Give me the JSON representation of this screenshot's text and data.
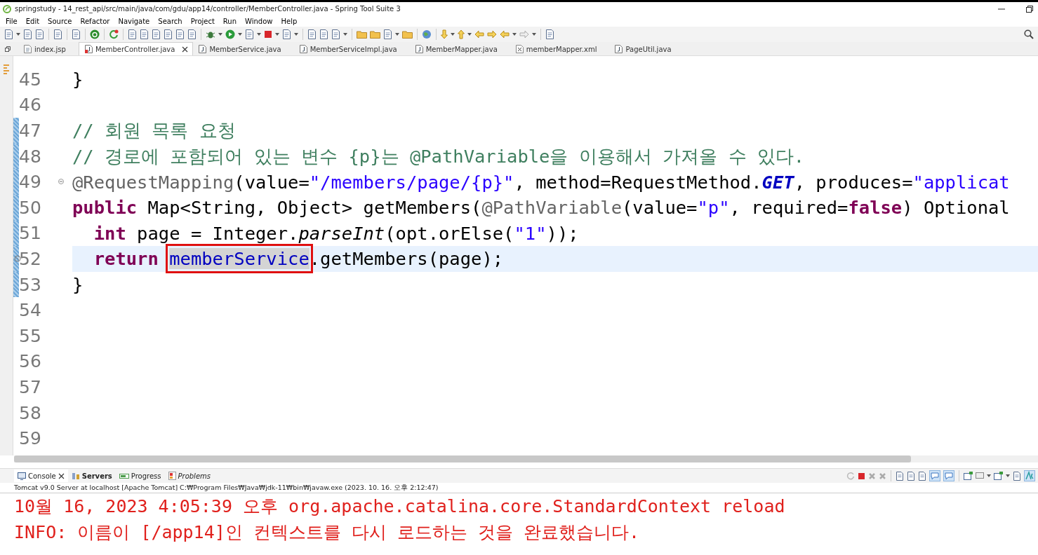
{
  "window": {
    "title": "springstudy - 14_rest_api/src/main/java/com/gdu/app14/controller/MemberController.java - Spring Tool Suite 3"
  },
  "menu": [
    "File",
    "Edit",
    "Source",
    "Refactor",
    "Navigate",
    "Search",
    "Project",
    "Run",
    "Window",
    "Help"
  ],
  "editor_tabs": [
    {
      "label": "index.jsp",
      "kind": "jsp",
      "selected": false
    },
    {
      "label": "MemberController.java",
      "kind": "java",
      "selected": true
    },
    {
      "label": "MemberService.java",
      "kind": "java",
      "selected": false
    },
    {
      "label": "MemberServiceImpl.java",
      "kind": "java",
      "selected": false
    },
    {
      "label": "MemberMapper.java",
      "kind": "java",
      "selected": false
    },
    {
      "label": "memberMapper.xml",
      "kind": "xml",
      "selected": false
    },
    {
      "label": "PageUtil.java",
      "kind": "java",
      "selected": false
    }
  ],
  "code_lines": [
    {
      "number": "45",
      "changed": false,
      "current": false,
      "tokens": [
        {
          "kind": "plain",
          "text": "}"
        }
      ]
    },
    {
      "number": "46",
      "changed": false,
      "current": false
    },
    {
      "number": "47",
      "changed": true,
      "current": false,
      "tokens": [
        {
          "kind": "comment",
          "text": "// 회원 목록 요청"
        }
      ]
    },
    {
      "number": "48",
      "changed": true,
      "current": false,
      "tokens": [
        {
          "kind": "comment",
          "text": "// 경로에 포함되어 있는 변수 {p}는 @PathVariable을 이용해서 가져올 수 있다."
        }
      ]
    },
    {
      "number": "49",
      "changed": true,
      "current": false,
      "folding": true,
      "tokens": [
        {
          "kind": "annotation",
          "text": "@RequestMapping"
        },
        {
          "kind": "plain",
          "text": "(value="
        },
        {
          "kind": "string",
          "text": "\"/members/page/{p}\""
        },
        {
          "kind": "plain",
          "text": ", method=RequestMethod."
        },
        {
          "kind": "constant",
          "text": "GET"
        },
        {
          "kind": "plain",
          "text": ", produces="
        },
        {
          "kind": "string",
          "text": "\"applicat"
        }
      ]
    },
    {
      "number": "50",
      "changed": true,
      "current": false,
      "children": [
        {
          "number": "51",
          "changed": true,
          "current": false,
          "tokens": [
            {
              "kind": "keyword",
              "text": "int"
            },
            {
              "kind": "plain",
              "text": " page = Integer."
            },
            {
              "kind": "static",
              "text": "parseInt"
            },
            {
              "kind": "plain",
              "text": "(opt.orElse("
            },
            {
              "kind": "string",
              "text": "\"1\""
            },
            {
              "kind": "plain",
              "text": "));"
            }
          ]
        },
        {
          "number": "52",
          "changed": true,
          "current": true,
          "warning": true,
          "tokens": [
            {
              "kind": "keyword",
              "text": "return "
            },
            {
              "kind": "field",
              "text": "memberService",
              "occurrence": true,
              "boxed": true
            },
            {
              "kind": "plain",
              "text": ".getMembers(page);"
            }
          ]
        }
      ],
      "tokens": [
        {
          "kind": "keyword",
          "text": "public"
        },
        {
          "kind": "plain",
          "text": " Map<String, Object> getMembers("
        },
        {
          "kind": "annotation",
          "text": "@PathVariable"
        },
        {
          "kind": "plain",
          "text": "(value="
        },
        {
          "kind": "string",
          "text": "\"p\""
        },
        {
          "kind": "plain",
          "text": ", required="
        },
        {
          "kind": "keyword",
          "text": "false"
        },
        {
          "kind": "plain",
          "text": ") Optional"
        }
      ]
    },
    {
      "number": "53",
      "changed": true,
      "current": false,
      "tokens": [
        {
          "kind": "plain",
          "text": "}"
        }
      ]
    },
    {
      "number": "54",
      "changed": false,
      "current": false
    },
    {
      "number": "55",
      "changed": false,
      "current": false
    },
    {
      "number": "56",
      "changed": false,
      "current": false
    },
    {
      "number": "57",
      "changed": false,
      "current": false
    },
    {
      "number": "58",
      "changed": false,
      "current": false
    },
    {
      "number": "59",
      "changed": false,
      "current": false
    }
  ],
  "console_tabs": [
    {
      "label": "Console",
      "kind": "console",
      "selected": true,
      "highlighted": false,
      "italic": false
    },
    {
      "label": "Servers",
      "kind": "servers",
      "selected": false,
      "highlighted": true,
      "italic": false
    },
    {
      "label": "Progress",
      "kind": "progress",
      "selected": false,
      "highlighted": false,
      "italic": false
    },
    {
      "label": "Problems",
      "kind": "problems",
      "selected": false,
      "highlighted": false,
      "italic": true
    }
  ],
  "console": {
    "process": "Tomcat v9.0 Server at localhost [Apache Tomcat] C:₩Program Files₩Java₩jdk-11₩bin₩javaw.exe  (2023. 10. 16. 오후 2:12:47)",
    "output": [
      {
        "text": "10월 16, 2023 4:05:39 오후 org.apache.catalina.core.StandardContext reload"
      },
      {
        "text": "INFO: 이름이 [/app14]인 컨텍스트를 다시 로드하는 것을 완료했습니다."
      }
    ]
  }
}
